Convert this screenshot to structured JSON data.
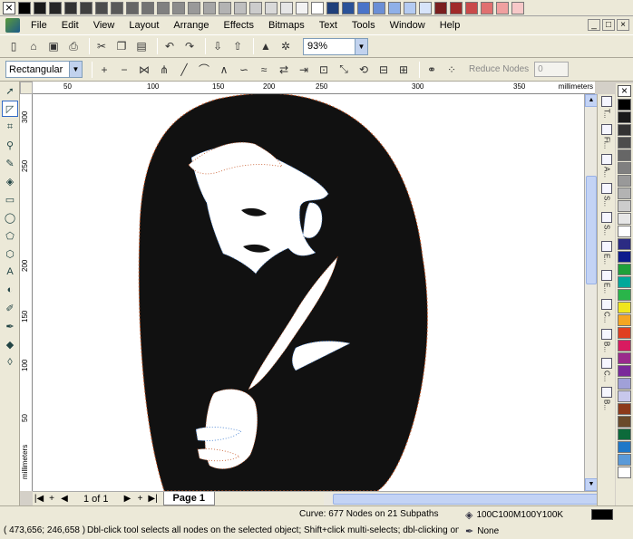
{
  "app": {
    "menu": [
      "File",
      "Edit",
      "View",
      "Layout",
      "Arrange",
      "Effects",
      "Bitmaps",
      "Text",
      "Tools",
      "Window",
      "Help"
    ],
    "window_controls": [
      "_",
      "□",
      "×"
    ]
  },
  "top_palette": {
    "colors": [
      "#000000",
      "#1a1a1a",
      "#262626",
      "#333333",
      "#404040",
      "#4d4d4d",
      "#595959",
      "#666666",
      "#737373",
      "#808080",
      "#8c8c8c",
      "#999999",
      "#a6a6a6",
      "#b3b3b3",
      "#bfbfbf",
      "#cccccc",
      "#d9d9d9",
      "#e6e6e6",
      "#f2f2f2",
      "#ffffff",
      "#1f3f7a",
      "#2a5298",
      "#4a74c9",
      "#6b8fd6",
      "#8fb0e8",
      "#b4cbf2",
      "#d7e4fa",
      "#7a1f1f",
      "#a02a2a",
      "#c94a4a",
      "#e07070",
      "#f0a0a0",
      "#f7c8c8"
    ]
  },
  "standard_toolbar": {
    "zoom": "93%",
    "icons": [
      "new-icon",
      "open-icon",
      "save-icon",
      "print-icon",
      "cut-icon",
      "copy-icon",
      "paste-icon",
      "undo-icon",
      "redo-icon",
      "import-icon",
      "export-icon",
      "app-launcher-icon",
      "corel-online-icon"
    ]
  },
  "property_bar": {
    "selection_mode": "Rectangular",
    "reduce_nodes_label": "Reduce Nodes",
    "reduce_nodes_value": "0"
  },
  "rulers": {
    "horizontal_labels": [
      "50",
      "100",
      "150",
      "200",
      "250",
      "300",
      "350"
    ],
    "horizontal_unit": "millimeters",
    "vertical_labels": [
      "300",
      "250",
      "200",
      "150",
      "100",
      "50"
    ],
    "vertical_unit": "millimeters"
  },
  "page_nav": {
    "count": "1 of 1",
    "tab": "Page 1"
  },
  "dockers": [
    "T...",
    "Fi...",
    "A...",
    "S...",
    "S...",
    "E...",
    "E...",
    "C...",
    "B...",
    "C...",
    "B..."
  ],
  "right_palette": {
    "colors": [
      "#000000",
      "#1a1a1a",
      "#333333",
      "#4d4d4d",
      "#666666",
      "#808080",
      "#999999",
      "#b3b3b3",
      "#cccccc",
      "#e6e6e6",
      "#ffffff",
      "#2b2b83",
      "#0d1a8c",
      "#1fa03a",
      "#00a89a",
      "#2ab54a",
      "#f0e61e",
      "#f5a623",
      "#e04020",
      "#d81b60",
      "#9a2a8c",
      "#7a2a9a",
      "#a0a0d8",
      "#c8c8ec",
      "#8c3a1a",
      "#6a4a2a",
      "#0c6a3a",
      "#1e78c8",
      "#5a9ad8",
      "#ffffff"
    ]
  },
  "status": {
    "object_info": "Curve: 677 Nodes on 21 Subpaths",
    "coords": "( 473,656; 246,658 )",
    "hint": "Dbl-click tool selects all nodes on the selected object; Shift+click multi-selects; dbl-clicking on a curve a...",
    "fill": "100C100M100Y100K",
    "outline": "None",
    "fill_color": "#000000"
  }
}
